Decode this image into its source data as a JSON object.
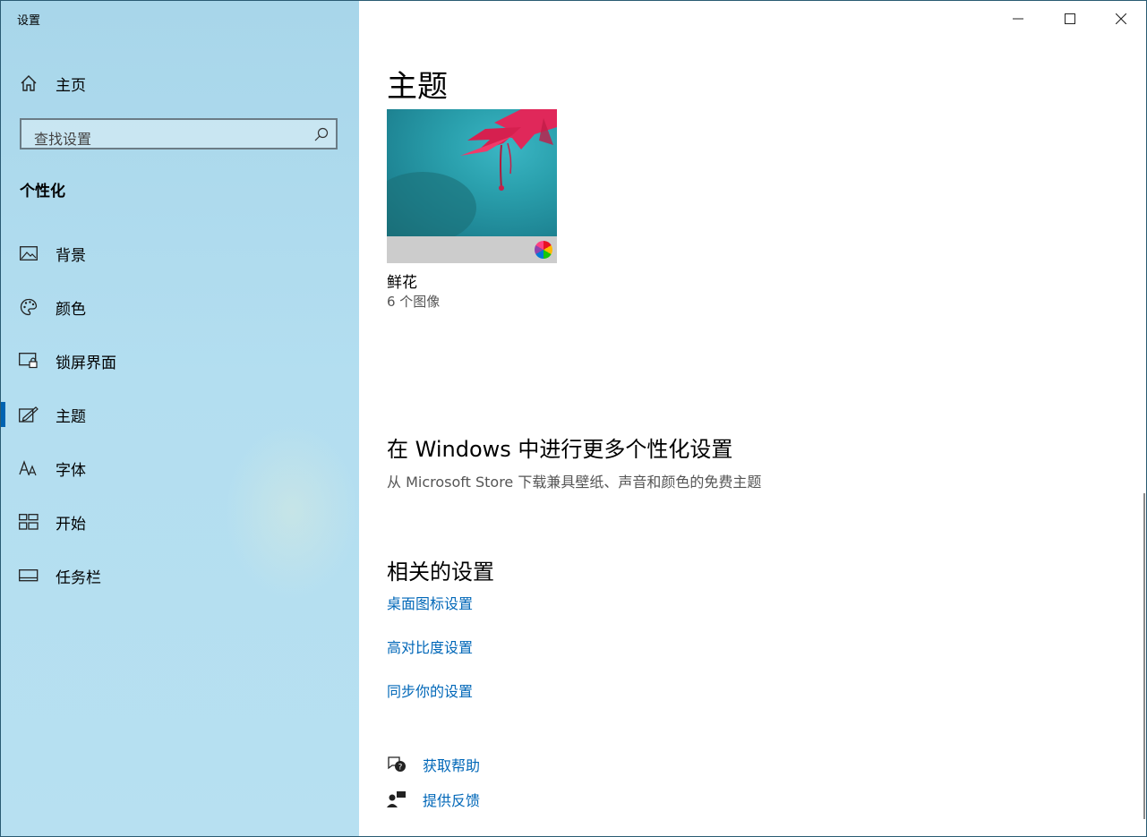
{
  "window": {
    "title": "设置"
  },
  "sidebar": {
    "home_label": "主页",
    "search_placeholder": "查找设置",
    "section_label": "个性化",
    "items": [
      {
        "label": "背景",
        "icon": "picture-icon"
      },
      {
        "label": "颜色",
        "icon": "palette-icon"
      },
      {
        "label": "锁屏界面",
        "icon": "lock-screen-icon"
      },
      {
        "label": "主题",
        "icon": "theme-icon",
        "active": true
      },
      {
        "label": "字体",
        "icon": "font-icon"
      },
      {
        "label": "开始",
        "icon": "start-icon"
      },
      {
        "label": "任务栏",
        "icon": "taskbar-icon"
      }
    ]
  },
  "main": {
    "title": "主题",
    "theme": {
      "name": "鲜花",
      "count": "6 个图像"
    },
    "more": {
      "title": "在 Windows 中进行更多个性化设置",
      "subtitle": "从 Microsoft Store 下载兼具壁纸、声音和颜色的免费主题"
    },
    "related": {
      "title": "相关的设置",
      "links": [
        "桌面图标设置",
        "高对比度设置",
        "同步你的设置"
      ]
    },
    "help": {
      "get_help": "获取帮助",
      "feedback": "提供反馈"
    }
  },
  "colors": {
    "accent": "#0063b1",
    "link": "#0067b8",
    "sidebar_bg": "#b3def0"
  }
}
